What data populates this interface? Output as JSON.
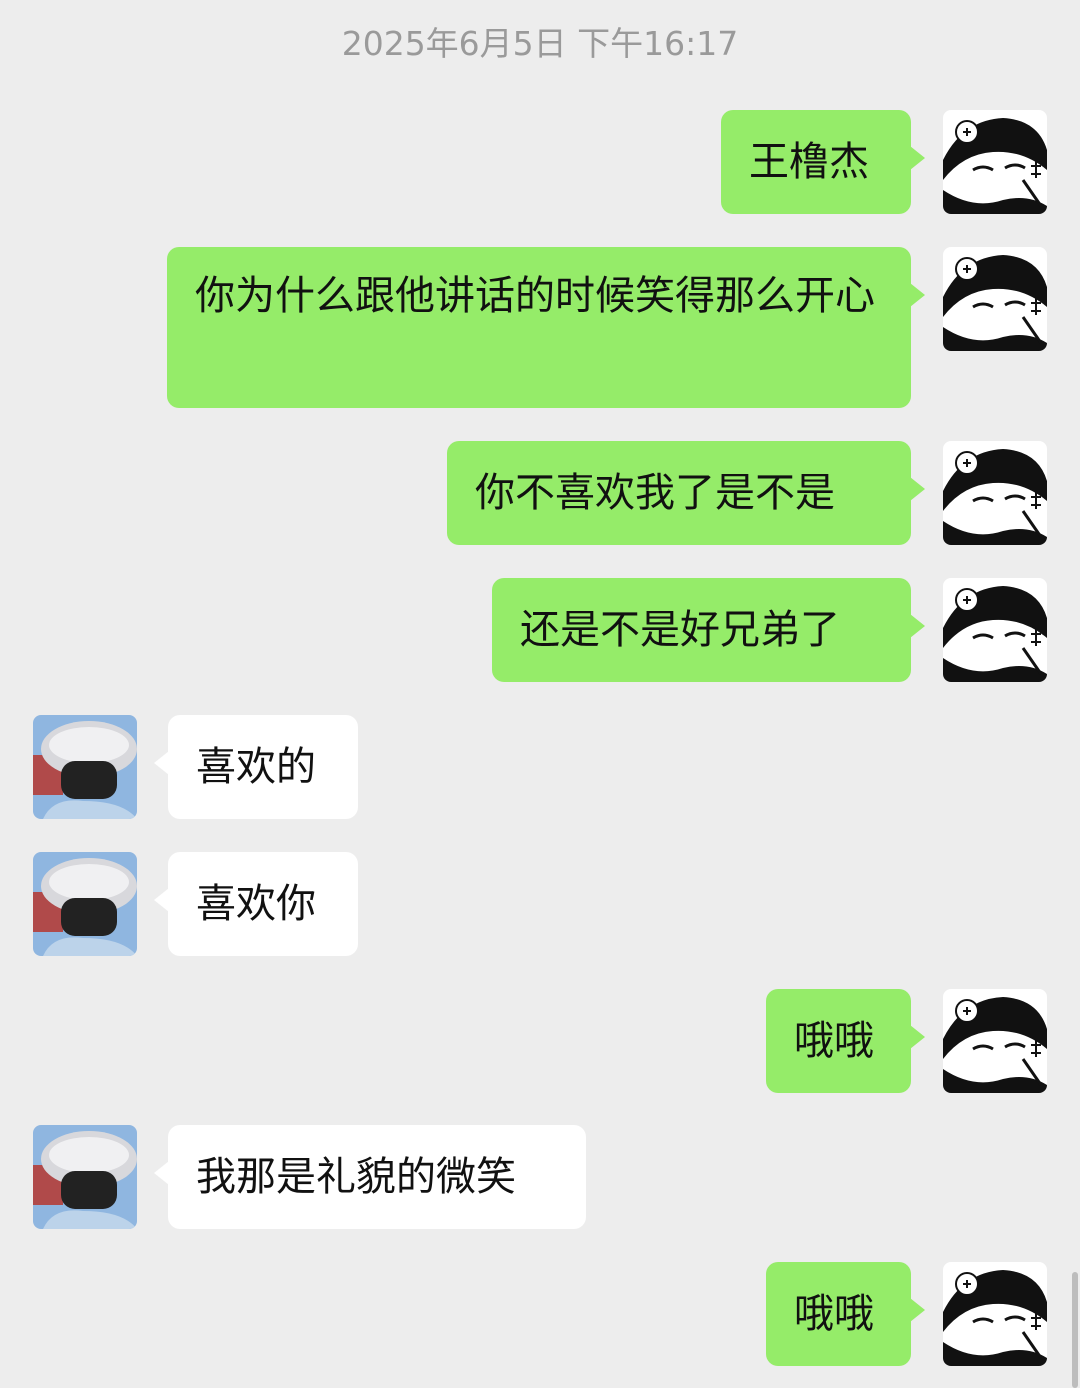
{
  "timestamp": "2025年6月5日 下午16:17",
  "messages": [
    {
      "side": "out",
      "text": "王橹杰"
    },
    {
      "side": "out",
      "text": "你为什么跟他讲话的时候笑得那么开心"
    },
    {
      "side": "out",
      "text": "你不喜欢我了是不是"
    },
    {
      "side": "out",
      "text": "还是不是好兄弟了"
    },
    {
      "side": "in",
      "text": "喜欢的"
    },
    {
      "side": "in",
      "text": "喜欢你"
    },
    {
      "side": "out",
      "text": "哦哦"
    },
    {
      "side": "in",
      "text": "我那是礼貌的微笑"
    },
    {
      "side": "out",
      "text": "哦哦"
    }
  ],
  "colors": {
    "background": "#ededed",
    "outgoing_bubble": "#95ec69",
    "incoming_bubble": "#ffffff",
    "timestamp_text": "#9a9a9a"
  },
  "icons": {
    "self_avatar": "manga-boy-avatar-icon",
    "contact_avatar": "masked-person-fur-hat-avatar-icon"
  }
}
